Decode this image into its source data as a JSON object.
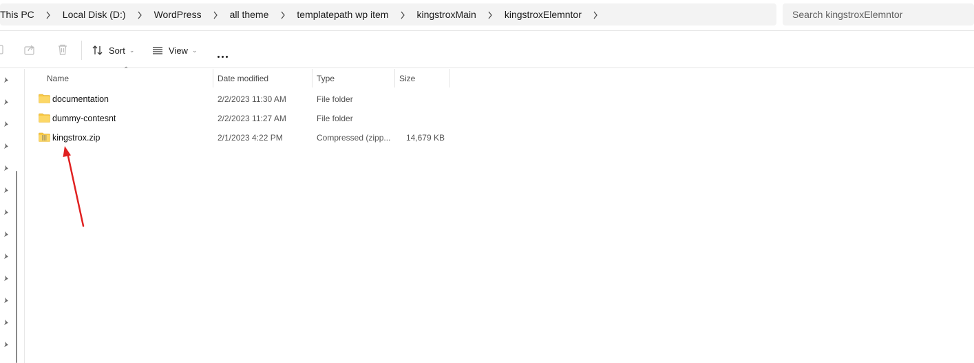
{
  "breadcrumb": {
    "items": [
      "This PC",
      "Local Disk (D:)",
      "WordPress",
      "all theme",
      "templatepath wp item",
      "kingstroxMain",
      "kingstroxElemntor"
    ]
  },
  "search": {
    "placeholder": "Search kingstroxElemntor"
  },
  "toolbar": {
    "sort_label": "Sort",
    "view_label": "View"
  },
  "columns": {
    "name": "Name",
    "date": "Date modified",
    "type": "Type",
    "size": "Size"
  },
  "files": [
    {
      "name": "documentation",
      "date": "2/2/2023 11:30 AM",
      "type": "File folder",
      "size": "",
      "icon": "folder-icon"
    },
    {
      "name": "dummy-contesnt",
      "date": "2/2/2023 11:27 AM",
      "type": "File folder",
      "size": "",
      "icon": "folder-icon"
    },
    {
      "name": "kingstrox.zip",
      "date": "2/1/2023 4:22 PM",
      "type": "Compressed (zipp...",
      "size": "14,679 KB",
      "icon": "zip-folder-icon"
    }
  ],
  "colors": {
    "folder": "#f8c844",
    "accent_arrow": "#e02020"
  }
}
